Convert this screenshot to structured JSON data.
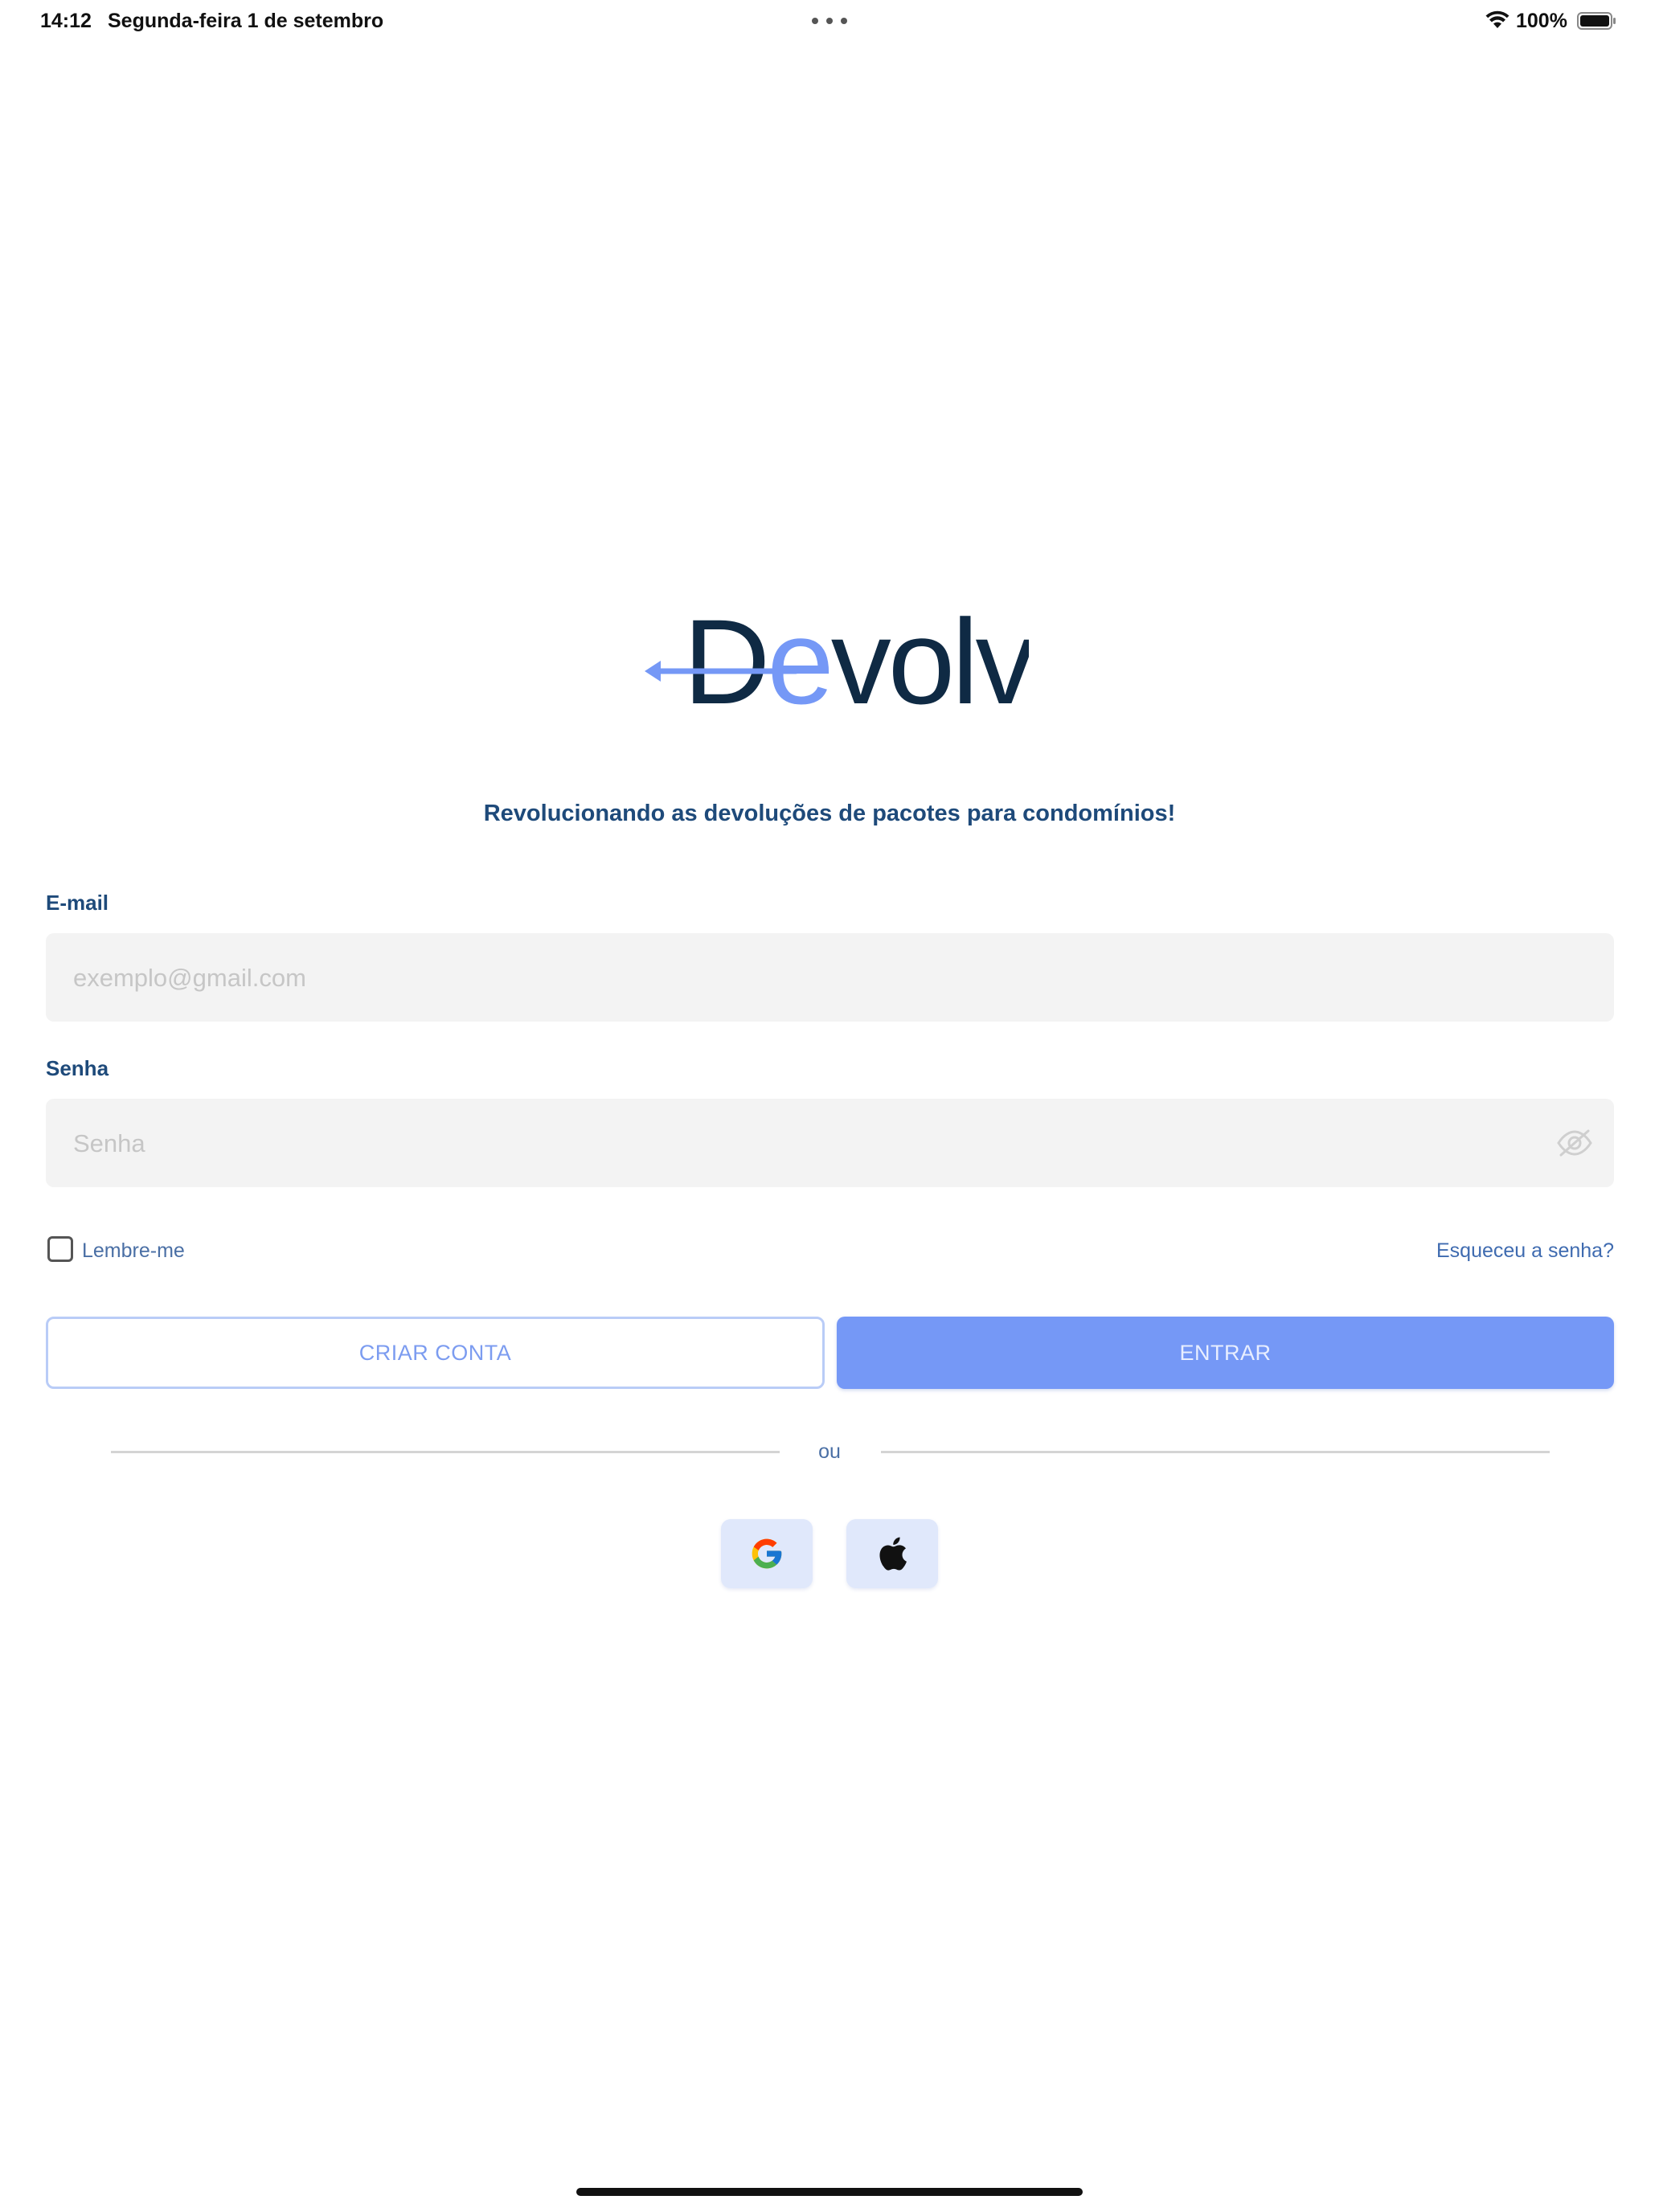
{
  "status_bar": {
    "time": "14:12",
    "date": "Segunda-feira 1 de setembro",
    "battery": "100%",
    "wifi_icon": "wifi-icon",
    "battery_icon": "battery-full-icon"
  },
  "brand": {
    "logo_text_accent": "De",
    "logo_text_rest": "volvi",
    "tagline": "Revolucionando as devoluções de pacotes para condomínios!",
    "colors": {
      "primary": "#7598f6",
      "navy": "#0f2a44",
      "label": "#1e4a7a"
    }
  },
  "form": {
    "email_label": "E-mail",
    "email_placeholder": "exemplo@gmail.com",
    "email_value": "",
    "password_label": "Senha",
    "password_placeholder": "Senha",
    "password_value": "",
    "password_visibility_icon": "eye-off-icon",
    "remember_label": "Lembre-me",
    "remember_checked": false,
    "forgot_label": "Esqueceu a senha?"
  },
  "actions": {
    "create_account_label": "CRIAR CONTA",
    "enter_label": "ENTRAR"
  },
  "divider": {
    "label": "ou"
  },
  "social": {
    "google_icon": "google-icon",
    "apple_icon": "apple-icon"
  }
}
